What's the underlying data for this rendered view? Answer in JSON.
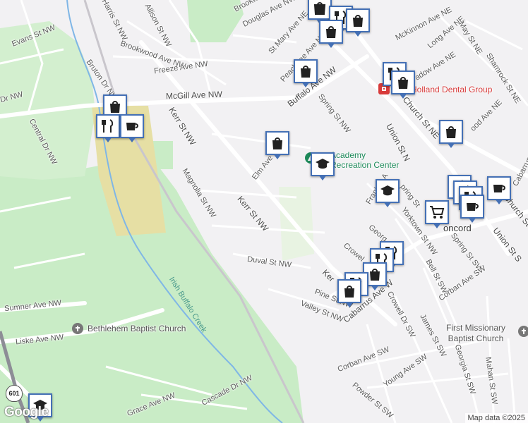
{
  "map": {
    "streets": [
      {
        "id": "douglas-ave",
        "text": "Douglas Ave NW"
      },
      {
        "id": "brookwood-top",
        "text": "Brookwo"
      },
      {
        "id": "harris-st",
        "text": "Harris St NW"
      },
      {
        "id": "allison-st",
        "text": "Allison St NW"
      },
      {
        "id": "evans-st",
        "text": "Evans St NW"
      },
      {
        "id": "brookwood-ave",
        "text": "Brookwood Ave NW"
      },
      {
        "id": "freeze-ave",
        "text": "Freeze Ave NW"
      },
      {
        "id": "bruton-dr",
        "text": "Bruton Dr NW"
      },
      {
        "id": "mcgill-ave",
        "text": "McGill Ave NW"
      },
      {
        "id": "central-dr-left",
        "text": "Dr NW"
      },
      {
        "id": "central-dr",
        "text": "Central Dr NW"
      },
      {
        "id": "kerr-st-top",
        "text": "Kerr St NW"
      },
      {
        "id": "magnolia-st",
        "text": "Magnolia St NW"
      },
      {
        "id": "elm-ave",
        "text": "Elm Ave"
      },
      {
        "id": "kerr-st-mid",
        "text": "Kerr St NW"
      },
      {
        "id": "duval-st",
        "text": "Duval St NW"
      },
      {
        "id": "st-mary-ave",
        "text": "St Mary Ave NE"
      },
      {
        "id": "peachtree-ave",
        "text": "Peachtree Ave N"
      },
      {
        "id": "buffalo-ave",
        "text": "Buffalo Ave NW"
      },
      {
        "id": "spring-st-nw",
        "text": "Spring St NW"
      },
      {
        "id": "mckinnon-ave",
        "text": "McKinnon Ave NE"
      },
      {
        "id": "long-ave",
        "text": "Long Ave NE"
      },
      {
        "id": "may-st",
        "text": "May St NE"
      },
      {
        "id": "shamrock-st",
        "text": "Shamrock St NE"
      },
      {
        "id": "meadow-ave",
        "text": "adow Ave NE"
      },
      {
        "id": "church-st-ne",
        "text": "Church St NE"
      },
      {
        "id": "union-st-n",
        "text": "Union St N"
      },
      {
        "id": "wood-ave",
        "text": "ood Ave NE"
      },
      {
        "id": "cabarrus-ave-e",
        "text": "Cabarrus Ave"
      },
      {
        "id": "franklin-ave",
        "text": "Franklin A"
      },
      {
        "id": "spring-st-fragment",
        "text": "pring St"
      },
      {
        "id": "yorktown-st",
        "text": "Yorktown St NW"
      },
      {
        "id": "concord",
        "text": "oncord"
      },
      {
        "id": "union-st-s",
        "text": "Union St S"
      },
      {
        "id": "church-st-s",
        "text": "Church St S"
      },
      {
        "id": "spring-st-sw",
        "text": "Spring St SW"
      },
      {
        "id": "george-st",
        "text": "Georg"
      },
      {
        "id": "crowell-st",
        "text": "Crowel"
      },
      {
        "id": "kerr-st-low",
        "text": "Ker"
      },
      {
        "id": "pine-st",
        "text": "Pine St NW"
      },
      {
        "id": "valley-st",
        "text": "Valley St NW"
      },
      {
        "id": "cabarrus-ave-w",
        "text": "Cabarrus Ave W"
      },
      {
        "id": "crowell-dr",
        "text": "Crowell Dr SW"
      },
      {
        "id": "bell-st",
        "text": "Bell St SW"
      },
      {
        "id": "corban-ave-1",
        "text": "Corban Ave SW"
      },
      {
        "id": "james-st",
        "text": "James St SW"
      },
      {
        "id": "corban-ave-2",
        "text": "Corban Ave SW"
      },
      {
        "id": "young-ave",
        "text": "Young Ave SW"
      },
      {
        "id": "georgia-st",
        "text": "Georgia St SW"
      },
      {
        "id": "mahan-st",
        "text": "Mahan St SW"
      },
      {
        "id": "powder-st",
        "text": "Powder St SW"
      },
      {
        "id": "sumner-ave",
        "text": "Sumner Ave NW"
      },
      {
        "id": "liske-ave",
        "text": "Liske Ave NW"
      },
      {
        "id": "grace-ave",
        "text": "Grace Ave NW"
      },
      {
        "id": "cascade-dr",
        "text": "Cascade Dr NW"
      }
    ],
    "creek_label": "Irish Buffalo Creek",
    "places": [
      {
        "id": "academy-rec",
        "text_line1": "Academy",
        "text_line2": "Recreation Center",
        "color": "#1e8a5a"
      },
      {
        "id": "dental",
        "text": "Holland Dental Group",
        "color": "#d83b3b"
      },
      {
        "id": "bethlehem",
        "text": "Bethlehem Baptist Church",
        "color": "#555555"
      },
      {
        "id": "first-missionary",
        "text_line1": "First Missionary",
        "text_line2": "Baptist Church",
        "color": "#555555"
      }
    ],
    "highway_shield": "601",
    "pins": [
      {
        "id": "pin-top-1",
        "icon": "shopping-bag-icon"
      },
      {
        "id": "pin-top-2",
        "icon": "restaurant-icon"
      },
      {
        "id": "pin-top-3",
        "icon": "shopping-bag-icon"
      },
      {
        "id": "pin-peachtree",
        "icon": "shopping-bag-icon"
      },
      {
        "id": "pin-dental-1",
        "icon": "restaurant-icon"
      },
      {
        "id": "pin-dental-2",
        "icon": "shopping-bag-icon"
      },
      {
        "id": "pin-mcgill-1",
        "icon": "shopping-bag-icon"
      },
      {
        "id": "pin-mcgill-2",
        "icon": "restaurant-icon"
      },
      {
        "id": "pin-mcgill-3",
        "icon": "coffee-cup-icon"
      },
      {
        "id": "pin-elm",
        "icon": "shopping-bag-icon"
      },
      {
        "id": "pin-ne",
        "icon": "shopping-bag-icon"
      },
      {
        "id": "pin-academy",
        "icon": "graduation-cap-icon"
      },
      {
        "id": "pin-franklin",
        "icon": "graduation-cap-icon"
      },
      {
        "id": "pin-cart",
        "icon": "shopping-cart-icon"
      },
      {
        "id": "pin-cluster-coffee-1",
        "icon": "coffee-cup-icon"
      },
      {
        "id": "pin-cluster-coffee-2",
        "icon": "coffee-cup-icon"
      },
      {
        "id": "pin-crowell-1",
        "icon": "restaurant-icon"
      },
      {
        "id": "pin-crowell-2",
        "icon": "shopping-bag-icon"
      },
      {
        "id": "pin-kerr-1",
        "icon": "shopping-bag-icon"
      },
      {
        "id": "pin-school-bottom",
        "icon": "graduation-cap-icon"
      }
    ]
  },
  "footer": {
    "logo_text": "Google",
    "attribution": "Map data ©2025"
  },
  "colors": {
    "background": "#f2f1f3",
    "park_green": "#c9ecc6",
    "road": "#ffffff",
    "water": "#7fb6e6",
    "campus": "#e6dfa4",
    "pin_border": "#4470b5",
    "rail": "#c9c6cc"
  }
}
